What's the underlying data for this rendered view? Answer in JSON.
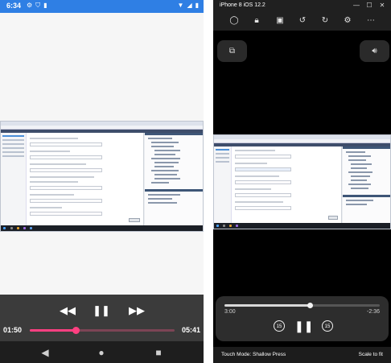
{
  "android": {
    "status": {
      "time": "6:34"
    },
    "media": {
      "current_time": "01:50",
      "duration": "05:41",
      "progress": 0.32
    }
  },
  "ios": {
    "window_title": "iPhone 8 iOS 12.2",
    "media": {
      "current_time": "3:00",
      "remaining_time": "-2:36",
      "skip_back_label": "15",
      "skip_forward_label": "15",
      "progress": 0.55
    },
    "touch_mode": "Touch Mode: Shallow Press",
    "scale": "Scale to fit"
  },
  "colors": {
    "android_status_bar": "#2f7fe4",
    "android_accent": "#ff4081",
    "android_media_bg": "#3b3b3b",
    "ios_bg": "#000000",
    "ios_media_bg": "#2d2d2d"
  },
  "icons": {
    "android_status": [
      "settings-icon",
      "shield-icon",
      "sd-card-icon",
      "wifi-icon",
      "signal-icon",
      "battery-icon"
    ],
    "android_media": [
      "rewind-icon",
      "pause-icon",
      "fast-forward-icon"
    ],
    "android_nav": [
      "back-icon",
      "home-icon",
      "recents-icon"
    ],
    "ios_toolbar": [
      "home-icon",
      "lock-icon",
      "screenshot-icon",
      "rotate-left-icon",
      "rotate-right-icon",
      "settings-icon",
      "more-icon"
    ],
    "ios_overlay": [
      "picture-in-picture-icon",
      "volume-icon"
    ],
    "ios_media": [
      "skip-back-15-icon",
      "pause-icon",
      "skip-forward-15-icon"
    ]
  }
}
